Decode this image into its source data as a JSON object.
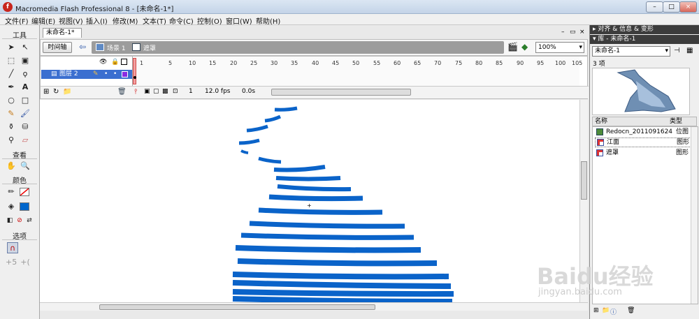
{
  "window": {
    "title": "Macromedia Flash Professional 8 - [未命名-1*]",
    "icon": "flash-icon",
    "controls": [
      "–",
      "□",
      "×"
    ]
  },
  "menubar": [
    "文件(F)",
    "编辑(E)",
    "视图(V)",
    "插入(I)",
    "修改(M)",
    "文本(T)",
    "命令(C)",
    "控制(O)",
    "窗口(W)",
    "帮助(H)"
  ],
  "tools": {
    "header": "工具",
    "view_header": "查看",
    "color_header": "颜色",
    "options_header": "选项",
    "stroke_color": "#000000",
    "fill_color": "#0066cc"
  },
  "document": {
    "tab": "未命名-1*",
    "timeline_button": "时间轴",
    "scene": "场景 1",
    "symbol": "遮罩",
    "zoom": "100%",
    "doc_controls": [
      "–",
      "▭",
      "×"
    ]
  },
  "timeline": {
    "layer_name": "图层 2",
    "frame_ticks": [
      "1",
      "5",
      "10",
      "15",
      "20",
      "25",
      "30",
      "35",
      "40",
      "45",
      "50",
      "55",
      "60",
      "65",
      "70",
      "75",
      "80",
      "85",
      "90",
      "95",
      "100",
      "105"
    ],
    "current_frame": "1",
    "fps": "12.0 fps",
    "elapsed": "0.0s"
  },
  "right_panel": {
    "align_panel_title": "对齐 & 信息 & 变形",
    "library_title": "库 - 未命名-1",
    "library_select": "未命名-1",
    "item_count": "3 项",
    "columns": {
      "name": "名称",
      "type": "类型"
    },
    "items": [
      {
        "name": "Redocn_2011091624…",
        "type": "位图",
        "icon": "bitmap-icon"
      },
      {
        "name": "江面",
        "type": "图形",
        "icon": "graphic-icon"
      },
      {
        "name": "遮罩",
        "type": "图形",
        "icon": "graphic-icon"
      }
    ]
  },
  "stage": {
    "stripe_color": "#0a63c9"
  },
  "watermark": {
    "text": "Baidu经验",
    "sub": "jingyan.baidu.com"
  }
}
